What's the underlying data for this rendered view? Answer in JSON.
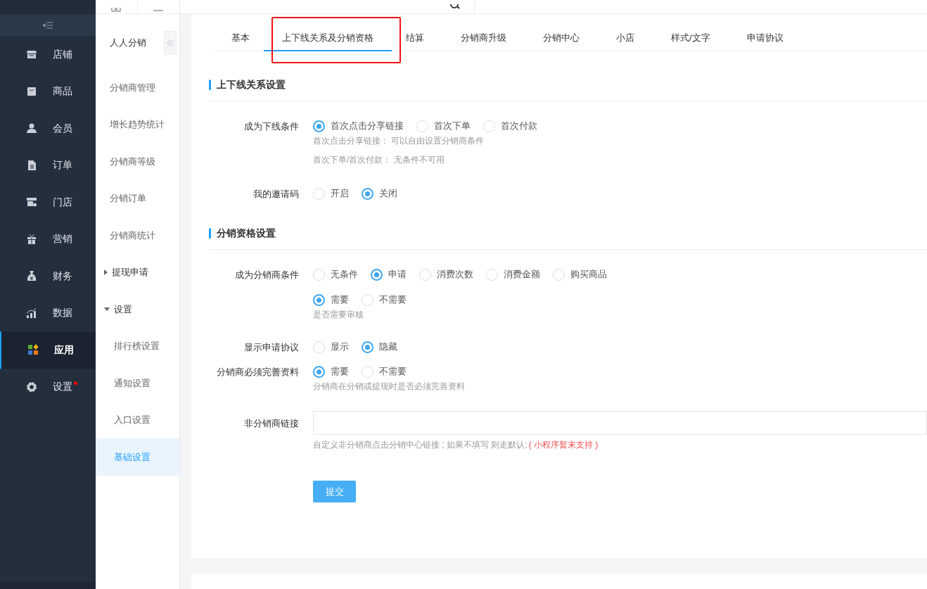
{
  "sidebar": {
    "items": [
      {
        "label": "店铺",
        "selected": false,
        "dot": false
      },
      {
        "label": "商品",
        "selected": false,
        "dot": false
      },
      {
        "label": "会员",
        "selected": false,
        "dot": false
      },
      {
        "label": "订单",
        "selected": false,
        "dot": false
      },
      {
        "label": "门店",
        "selected": false,
        "dot": false
      },
      {
        "label": "营销",
        "selected": false,
        "dot": false
      },
      {
        "label": "财务",
        "selected": false,
        "dot": false
      },
      {
        "label": "数据",
        "selected": false,
        "dot": false
      },
      {
        "label": "应用",
        "selected": true,
        "dot": false
      },
      {
        "label": "设置",
        "selected": false,
        "dot": true
      }
    ]
  },
  "subnav": {
    "title": "人人分销",
    "items": [
      {
        "kind": "link",
        "label": "分销商管理",
        "selected": false
      },
      {
        "kind": "link",
        "label": "增长趋势统计",
        "selected": false
      },
      {
        "kind": "link",
        "label": "分销商等级",
        "selected": false
      },
      {
        "kind": "link",
        "label": "分销订单",
        "selected": false
      },
      {
        "kind": "link",
        "label": "分销商统计",
        "selected": false
      },
      {
        "kind": "group",
        "label": "提现申请",
        "expanded": false
      },
      {
        "kind": "group",
        "label": "设置",
        "expanded": true,
        "children": [
          {
            "label": "排行榜设置",
            "selected": false
          },
          {
            "label": "通知设置",
            "selected": false
          },
          {
            "label": "入口设置",
            "selected": false
          },
          {
            "label": "基础设置",
            "selected": true
          }
        ]
      }
    ]
  },
  "tabs": [
    {
      "label": "基本",
      "selected": false
    },
    {
      "label": "上下线关系及分销资格",
      "selected": true
    },
    {
      "label": "结算",
      "selected": false
    },
    {
      "label": "分销商升级",
      "selected": false
    },
    {
      "label": "分销中心",
      "selected": false
    },
    {
      "label": "小店",
      "selected": false
    },
    {
      "label": "样式/文字",
      "selected": false
    },
    {
      "label": "申请协议",
      "selected": false
    }
  ],
  "sections": [
    {
      "title": "上下线关系设置",
      "fields": [
        {
          "kind": "radio",
          "label": "成为下线条件",
          "options": [
            {
              "label": "首次点击分享链接",
              "selected": true
            },
            {
              "label": "首次下单",
              "selected": false
            },
            {
              "label": "首次付款",
              "selected": false
            }
          ],
          "help": [
            "首次点击分享链接： 可以自由设置分销商条件",
            "首次下单/首次付款： 无条件不可用"
          ]
        },
        {
          "kind": "radio",
          "label": "我的邀请码",
          "options": [
            {
              "label": "开启",
              "selected": false
            },
            {
              "label": "关闭",
              "selected": true
            }
          ]
        }
      ]
    },
    {
      "title": "分销资格设置",
      "fields": [
        {
          "kind": "radio",
          "label": "成为分销商条件",
          "options": [
            {
              "label": "无条件",
              "selected": false
            },
            {
              "label": "申请",
              "selected": true
            },
            {
              "label": "消费次数",
              "selected": false
            },
            {
              "label": "消费金额",
              "selected": false
            },
            {
              "label": "购买商品",
              "selected": false
            }
          ]
        },
        {
          "kind": "radio",
          "options": [
            {
              "label": "需要",
              "selected": true
            },
            {
              "label": "不需要",
              "selected": false
            }
          ],
          "help": [
            "是否需要审核"
          ]
        },
        {
          "kind": "radio",
          "label": "显示申请协议",
          "options": [
            {
              "label": "显示",
              "selected": false
            },
            {
              "label": "隐藏",
              "selected": true
            }
          ]
        },
        {
          "kind": "radio",
          "label": "分销商必须完善资料",
          "options": [
            {
              "label": "需要",
              "selected": true
            },
            {
              "label": "不需要",
              "selected": false
            }
          ],
          "help": [
            "分销商在分销或提现时是否必须完善资料"
          ]
        },
        {
          "kind": "text",
          "label": "非分销商链接",
          "help": [
            "自定义非分销商点击分销中心链接 ; 如果不填写 则走默认;"
          ],
          "warning": "( 小程序暂末支持 )"
        }
      ]
    }
  ],
  "submit": {
    "label": "提交"
  }
}
